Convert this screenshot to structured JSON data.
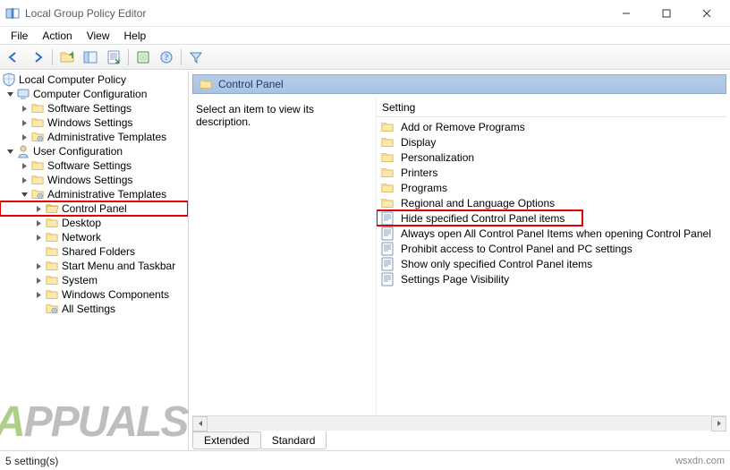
{
  "window": {
    "title": "Local Group Policy Editor"
  },
  "menu": {
    "file": "File",
    "action": "Action",
    "view": "View",
    "help": "Help"
  },
  "toolbar": {
    "back": "back",
    "forward": "forward",
    "up": "up",
    "options": "options",
    "export": "export",
    "refresh": "refresh",
    "help": "help",
    "filter": "filter"
  },
  "tree": {
    "root": "Local Computer Policy",
    "cc": "Computer Configuration",
    "cc_items": [
      "Software Settings",
      "Windows Settings",
      "Administrative Templates"
    ],
    "uc": "User Configuration",
    "uc_items": [
      "Software Settings",
      "Windows Settings"
    ],
    "uc_at": "Administrative Templates",
    "at_items": [
      "Control Panel",
      "Desktop",
      "Network",
      "Shared Folders",
      "Start Menu and Taskbar",
      "System",
      "Windows Components",
      "All Settings"
    ],
    "selected": "Control Panel"
  },
  "pane": {
    "title": "Control Panel",
    "description": "Select an item to view its description.",
    "column_header": "Setting"
  },
  "settings": {
    "folders": [
      "Add or Remove Programs",
      "Display",
      "Personalization",
      "Printers",
      "Programs",
      "Regional and Language Options"
    ],
    "policies": [
      "Hide specified Control Panel items",
      "Always open All Control Panel Items when opening Control Panel",
      "Prohibit access to Control Panel and PC settings",
      "Show only specified Control Panel items",
      "Settings Page Visibility"
    ],
    "highlighted": "Hide specified Control Panel items"
  },
  "tabs": {
    "extended": "Extended",
    "standard": "Standard"
  },
  "status": "5 setting(s)",
  "attribution": "wsxdn.com"
}
